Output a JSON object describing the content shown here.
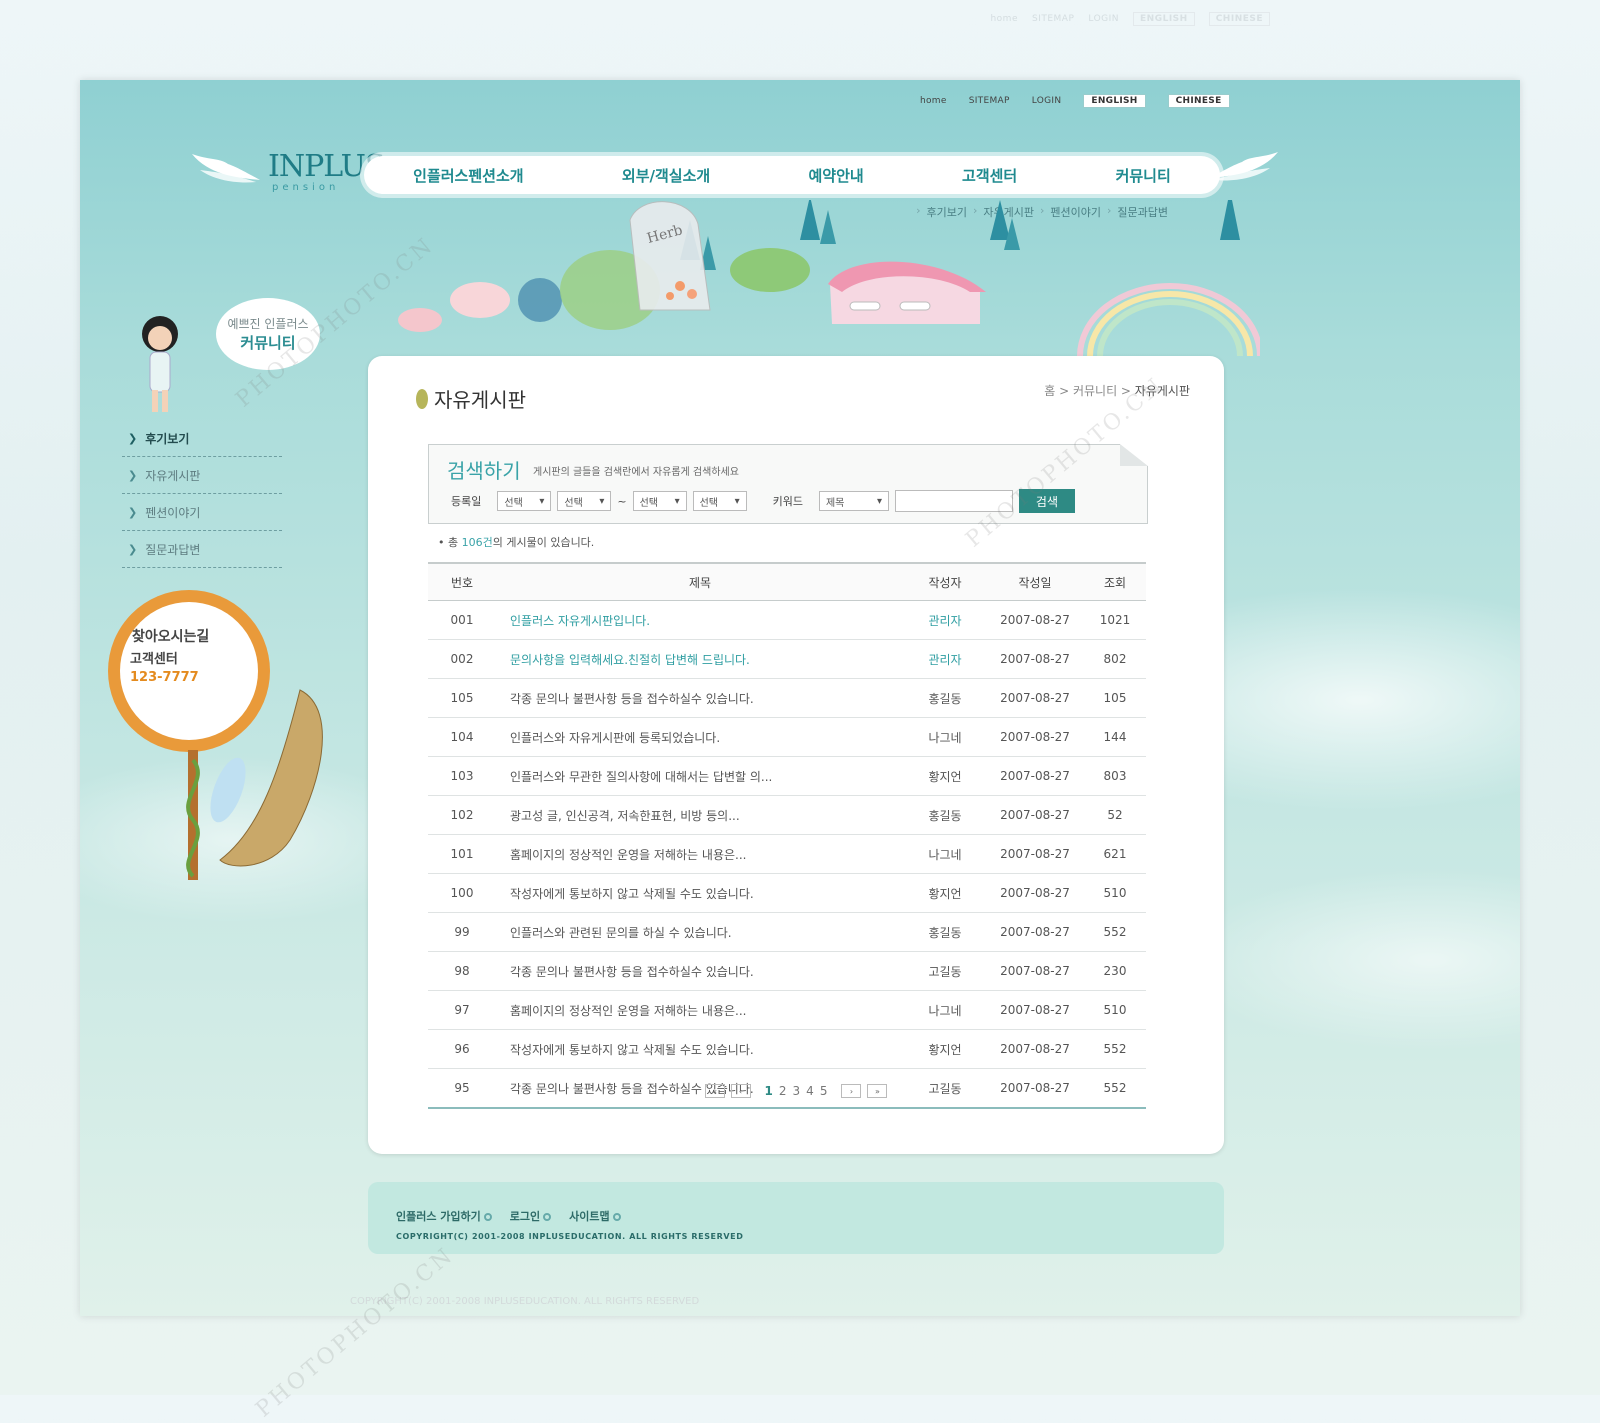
{
  "outer_nav": [
    "home",
    "SITEMAP",
    "LOGIN",
    "ENGLISH",
    "CHINESE"
  ],
  "util": {
    "home": "home",
    "sitemap": "SITEMAP",
    "login": "LOGIN",
    "english": "ENGLISH",
    "chinese": "CHINESE"
  },
  "logo": {
    "name": "INPLUS",
    "sub": "pension"
  },
  "main_nav": [
    "인플러스펜션소개",
    "외부/객실소개",
    "예약안내",
    "고객센터",
    "커뮤니티"
  ],
  "sub_nav": [
    "후기보기",
    "자유게시판",
    "펜션이야기",
    "질문과답변"
  ],
  "sidebar": {
    "bubble_line1": "예쁘진 인플러스",
    "bubble_line2": "커뮤니티",
    "items": [
      {
        "label": "후기보기",
        "active": true
      },
      {
        "label": "자유게시판",
        "active": false
      },
      {
        "label": "펜션이야기",
        "active": false
      },
      {
        "label": "질문과답변",
        "active": false
      }
    ],
    "sign_line1": "찾아오시는길",
    "sign_line2": "고객센터",
    "sign_phone": "123-7777"
  },
  "page": {
    "title": "자유게시판",
    "breadcrumb": "홈 > 커뮤니티 > ",
    "breadcrumb_last": "자유게시판"
  },
  "search": {
    "title": "검색하기",
    "desc": "게시판의 글들을 검색란에서 자유롭게 검색하세요",
    "date_label": "등록일",
    "select_default": "선택",
    "dash": "~",
    "keyword_label": "키워드",
    "keyword_select": "제목",
    "keyword_value": "",
    "button": "검색"
  },
  "total": {
    "prefix": "• 총 ",
    "count": "106건",
    "suffix": "의 게시물이 있습니다."
  },
  "table": {
    "headers": [
      "번호",
      "제목",
      "작성자",
      "작성일",
      "조회"
    ],
    "rows": [
      {
        "no": "001",
        "title": "인플러스 자유게시판입니다.",
        "writer": "관리자",
        "date": "2007-08-27",
        "views": "1021",
        "notice": true
      },
      {
        "no": "002",
        "title": "문의사항을 입력해세요.친절히 답변해 드립니다.",
        "writer": "관리자",
        "date": "2007-08-27",
        "views": "802",
        "notice": true
      },
      {
        "no": "105",
        "title": "각종 문의나 불편사항 등을 접수하실수 있습니다.",
        "writer": "홍길동",
        "date": "2007-08-27",
        "views": "105"
      },
      {
        "no": "104",
        "title": "인플러스와 자유게시판에 등록되었습니다.",
        "writer": "나그네",
        "date": "2007-08-27",
        "views": "144"
      },
      {
        "no": "103",
        "title": "인플러스와 무관한 질의사항에 대해서는 답변할 의...",
        "writer": "황지언",
        "date": "2007-08-27",
        "views": "803"
      },
      {
        "no": "102",
        "title": "광고성 글, 인신공격, 저속한표현, 비방 등의...",
        "writer": "홍길동",
        "date": "2007-08-27",
        "views": "52"
      },
      {
        "no": "101",
        "title": "홈페이지의 정상적인 운영을 저해하는 내용은...",
        "writer": "나그네",
        "date": "2007-08-27",
        "views": "621"
      },
      {
        "no": "100",
        "title": "작성자에게 통보하지 않고 삭제될 수도 있습니다.",
        "writer": "황지언",
        "date": "2007-08-27",
        "views": "510"
      },
      {
        "no": "99",
        "title": "인플러스와 관련된 문의를 하실 수 있습니다.",
        "writer": "홍길동",
        "date": "2007-08-27",
        "views": "552"
      },
      {
        "no": "98",
        "title": "각종 문의나 불편사항 등을 접수하실수 있습니다.",
        "writer": "고길동",
        "date": "2007-08-27",
        "views": "230"
      },
      {
        "no": "97",
        "title": "홈페이지의 정상적인 운영을 저해하는 내용은...",
        "writer": "나그네",
        "date": "2007-08-27",
        "views": "510"
      },
      {
        "no": "96",
        "title": "작성자에게 통보하지 않고 삭제될 수도 있습니다.",
        "writer": "황지언",
        "date": "2007-08-27",
        "views": "552"
      },
      {
        "no": "95",
        "title": "각종 문의나 불편사항 등을 접수하실수 있습니다.",
        "writer": "고길동",
        "date": "2007-08-27",
        "views": "552"
      }
    ]
  },
  "pager": {
    "first": "«",
    "prev": "‹",
    "pages": [
      "1",
      "2",
      "3",
      "4",
      "5"
    ],
    "current": "1",
    "next": "›",
    "last": "»"
  },
  "footer": {
    "links": [
      "인플러스 가입하기",
      "로그인",
      "사이트맵"
    ],
    "copyright": "COPYRIGHT(C) 2001-2008 INPLUSEDUCATION. ALL RIGHTS RESERVED"
  },
  "scene": {
    "herb_sign": "Herb"
  },
  "watermark": "PHOTOPHOTO.CN",
  "colors": {
    "accent": "#2e8a84",
    "nav_text": "#1f8a8f",
    "notice": "#2f9ea2",
    "sign_orange": "#e99a3a"
  }
}
